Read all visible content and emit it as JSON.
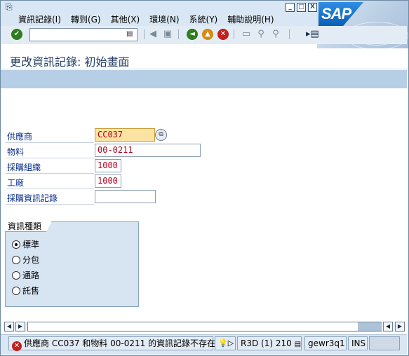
{
  "menu": {
    "items": [
      "資訊記錄(I)",
      "轉到(G)",
      "其他(X)",
      "環境(N)",
      "系統(Y)",
      "輔助說明(H)"
    ]
  },
  "window_controls": {
    "minimize": "_",
    "maximize": "□",
    "close": "X"
  },
  "brand": {
    "logo_text": "SAP"
  },
  "toolbar": {
    "command_field_value": "",
    "icons": [
      "enter-icon",
      "back-icon",
      "exit-icon",
      "cancel-icon",
      "print-icon",
      "find-icon",
      "find-next-icon",
      "layout-icon"
    ]
  },
  "page": {
    "title": "更改資訊記錄: 初始畫面"
  },
  "form": {
    "vendor_label": "供應商",
    "vendor_value": "CC037",
    "material_label": "物料",
    "material_value": "00-0211",
    "purch_org_label": "採購組織",
    "purch_org_value": "1000",
    "plant_label": "工廠",
    "plant_value": "1000",
    "info_record_label": "採購資訊記錄",
    "info_record_value": ""
  },
  "info_category": {
    "title": "資訊種類",
    "options": [
      "標準",
      "分包",
      "通路",
      "託售"
    ],
    "selected": "標準"
  },
  "status": {
    "message": "供應商 CC037 和物料 00-0211 的資訊記錄不存在",
    "system": "R3D (1) 210",
    "server": "gewr3q1",
    "mode": "INS"
  },
  "colors": {
    "menubar": "#d9e6f3",
    "app_toolbar": "#b7cfe6",
    "required_field": "#fbe3a4",
    "field_text": "#b3001b",
    "label_text": "#0a2f8a",
    "error": "#c2201b"
  }
}
